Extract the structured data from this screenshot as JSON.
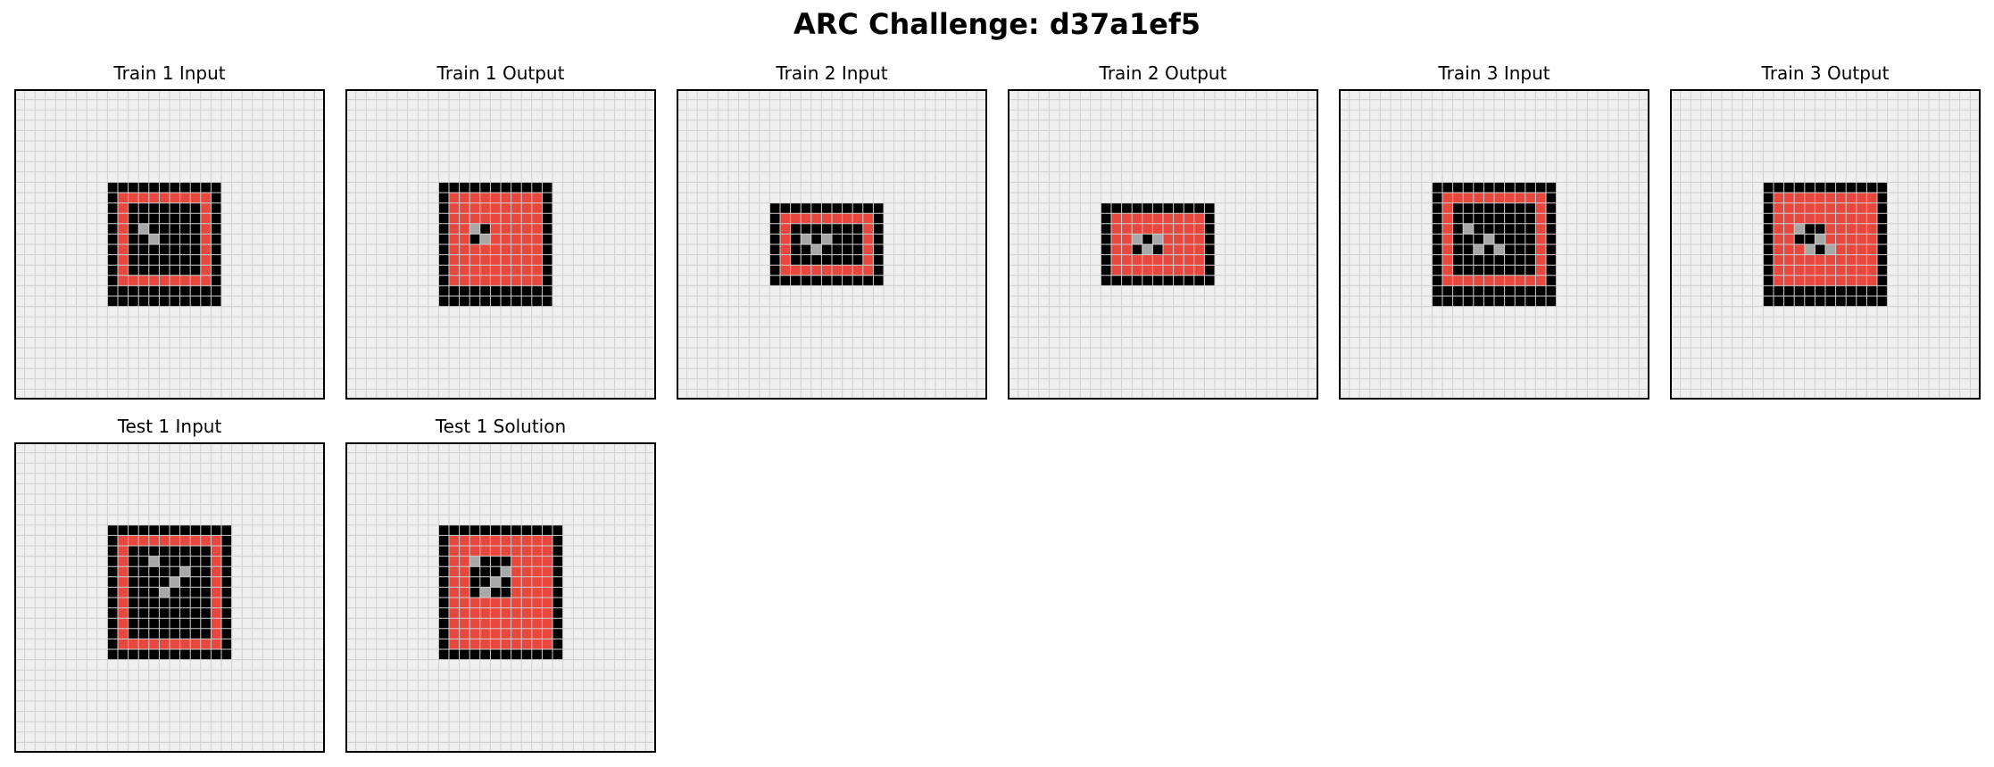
{
  "title": "ARC Challenge: d37a1ef5",
  "colors": {
    "0": "#efefef",
    "1": "#000000",
    "2": "#e8473d",
    "5": "#a8a8a8",
    "gridline": "#cfcfcf",
    "border": "#000000"
  },
  "panels": [
    {
      "label": "Train 1 Input",
      "size": 30,
      "rects": [
        [
          9,
          9,
          11,
          12,
          1
        ],
        [
          10,
          10,
          9,
          9,
          2
        ],
        [
          11,
          11,
          7,
          7,
          1
        ],
        [
          12,
          13,
          1,
          1,
          5
        ],
        [
          13,
          14,
          1,
          1,
          5
        ]
      ]
    },
    {
      "label": "Train 1 Output",
      "size": 30,
      "rects": [
        [
          9,
          9,
          11,
          12,
          1
        ],
        [
          10,
          10,
          9,
          9,
          2
        ],
        [
          12,
          13,
          1,
          1,
          5
        ],
        [
          13,
          14,
          1,
          1,
          5
        ],
        [
          12,
          14,
          1,
          1,
          1
        ],
        [
          13,
          13,
          1,
          1,
          1
        ]
      ]
    },
    {
      "label": "Train 2 Input",
      "size": 30,
      "rects": [
        [
          9,
          11,
          11,
          8,
          1
        ],
        [
          10,
          12,
          9,
          6,
          2
        ],
        [
          11,
          13,
          7,
          4,
          1
        ],
        [
          12,
          14,
          1,
          1,
          5
        ],
        [
          14,
          14,
          1,
          1,
          5
        ],
        [
          13,
          15,
          1,
          1,
          5
        ]
      ]
    },
    {
      "label": "Train 2 Output",
      "size": 30,
      "rects": [
        [
          9,
          11,
          11,
          8,
          1
        ],
        [
          10,
          12,
          9,
          6,
          2
        ],
        [
          12,
          14,
          1,
          1,
          5
        ],
        [
          14,
          14,
          1,
          1,
          5
        ],
        [
          13,
          15,
          1,
          1,
          5
        ],
        [
          13,
          14,
          1,
          1,
          1
        ],
        [
          12,
          15,
          1,
          1,
          1
        ],
        [
          14,
          15,
          1,
          1,
          1
        ]
      ]
    },
    {
      "label": "Train 3 Input",
      "size": 30,
      "rects": [
        [
          9,
          9,
          12,
          12,
          1
        ],
        [
          10,
          10,
          10,
          9,
          2
        ],
        [
          11,
          11,
          8,
          7,
          1
        ],
        [
          12,
          13,
          1,
          1,
          5
        ],
        [
          14,
          14,
          1,
          1,
          5
        ],
        [
          13,
          15,
          1,
          1,
          5
        ],
        [
          15,
          15,
          1,
          1,
          5
        ]
      ]
    },
    {
      "label": "Train 3 Output",
      "size": 30,
      "rects": [
        [
          9,
          9,
          12,
          12,
          1
        ],
        [
          10,
          10,
          10,
          9,
          2
        ],
        [
          12,
          13,
          1,
          1,
          5
        ],
        [
          14,
          14,
          1,
          1,
          5
        ],
        [
          13,
          15,
          1,
          1,
          5
        ],
        [
          15,
          15,
          1,
          1,
          5
        ],
        [
          13,
          13,
          2,
          1,
          1
        ],
        [
          12,
          14,
          2,
          1,
          1
        ],
        [
          14,
          15,
          1,
          1,
          1
        ]
      ]
    },
    {
      "label": "Test 1 Input",
      "size": 30,
      "rects": [
        [
          9,
          8,
          12,
          13,
          1
        ],
        [
          10,
          9,
          10,
          11,
          2
        ],
        [
          11,
          10,
          8,
          9,
          1
        ],
        [
          13,
          11,
          1,
          1,
          5
        ],
        [
          16,
          12,
          1,
          1,
          5
        ],
        [
          15,
          13,
          1,
          1,
          5
        ],
        [
          14,
          14,
          1,
          1,
          5
        ]
      ]
    },
    {
      "label": "Test 1 Solution",
      "size": 30,
      "rects": [
        [
          9,
          8,
          12,
          13,
          1
        ],
        [
          10,
          9,
          10,
          11,
          2
        ],
        [
          12,
          11,
          4,
          4,
          1
        ],
        [
          12,
          11,
          1,
          1,
          5
        ],
        [
          15,
          12,
          1,
          1,
          5
        ],
        [
          14,
          13,
          1,
          1,
          5
        ],
        [
          13,
          14,
          1,
          1,
          5
        ]
      ]
    }
  ]
}
